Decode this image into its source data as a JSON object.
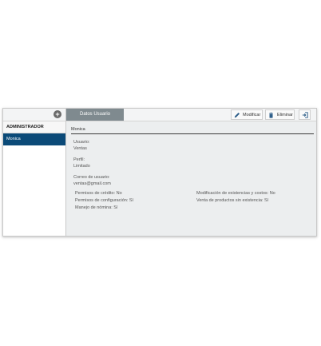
{
  "sidebar": {
    "group_label": "ADMINISTRADOR",
    "users": [
      "Monica"
    ]
  },
  "toolbar": {
    "tab_label": "Datos Usuario",
    "modify_label": "Modificar",
    "delete_label": "Eliminar"
  },
  "detail": {
    "name": "Monica",
    "usuario_label": "Usuario:",
    "usuario_value": "Ventas",
    "perfil_label": "Perfil:",
    "perfil_value": "Limitado",
    "correo_label": "Correo de usuario:",
    "correo_value": "ventas@gmail.com"
  },
  "permissions": {
    "left": [
      "Permisos de crédito: No",
      "Permisos de configuración: Sí",
      "Manejo de nómina: Sí"
    ],
    "right": [
      "Modificación de existencias y costos: No",
      "Venta de productos sin existencia: Sí"
    ]
  },
  "icons": {
    "add": "add-circle-icon",
    "modify": "pencil-icon",
    "delete": "trash-icon",
    "exit": "exit-icon"
  },
  "colors": {
    "selected": "#0b4a78",
    "tab": "#7f8a8f",
    "panel": "#eceeef"
  }
}
